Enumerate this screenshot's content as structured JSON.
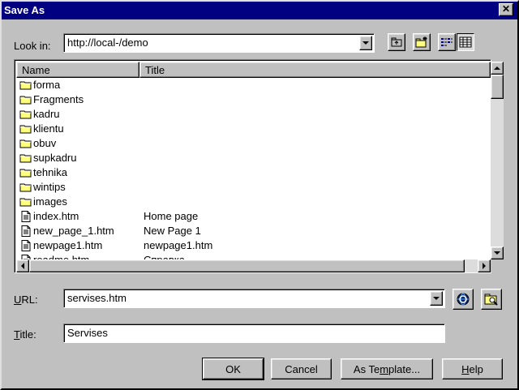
{
  "window": {
    "title": "Save As",
    "close_glyph": "✕"
  },
  "look_in": {
    "label": "Look in:",
    "value": "http://local-/demo"
  },
  "toolbar": {
    "icons": [
      "up-folder-icon",
      "new-folder-icon",
      "list-view-icon",
      "details-view-icon"
    ]
  },
  "file_list": {
    "columns": [
      "Name",
      "Title"
    ],
    "rows": [
      {
        "type": "folder",
        "name": "forma",
        "title": ""
      },
      {
        "type": "folder",
        "name": "Fragments",
        "title": ""
      },
      {
        "type": "folder",
        "name": "kadru",
        "title": ""
      },
      {
        "type": "folder",
        "name": "klientu",
        "title": ""
      },
      {
        "type": "folder",
        "name": "obuv",
        "title": ""
      },
      {
        "type": "folder",
        "name": "supkadru",
        "title": ""
      },
      {
        "type": "folder",
        "name": "tehnika",
        "title": ""
      },
      {
        "type": "folder",
        "name": "wintips",
        "title": ""
      },
      {
        "type": "folder",
        "name": "images",
        "title": ""
      },
      {
        "type": "file",
        "name": "index.htm",
        "title": "Home page"
      },
      {
        "type": "file",
        "name": "new_page_1.htm",
        "title": "New Page 1"
      },
      {
        "type": "file",
        "name": "newpage1.htm",
        "title": "newpage1.htm"
      },
      {
        "type": "file",
        "name": "readme.htm",
        "title": "Справка"
      }
    ]
  },
  "url": {
    "label_u": "U",
    "label_rest": "RL:",
    "value": "servises.htm"
  },
  "title_field": {
    "label_u": "T",
    "label_rest": "itle:",
    "value": "Servises"
  },
  "buttons": {
    "ok": "OK",
    "cancel": "Cancel",
    "as_template_pre": "As Te",
    "as_template_u": "m",
    "as_template_post": "plate...",
    "help_u": "H",
    "help_rest": "elp"
  },
  "colors": {
    "titlebar": "#000080",
    "face": "#c0c0c0",
    "folder": "#ffff80"
  }
}
